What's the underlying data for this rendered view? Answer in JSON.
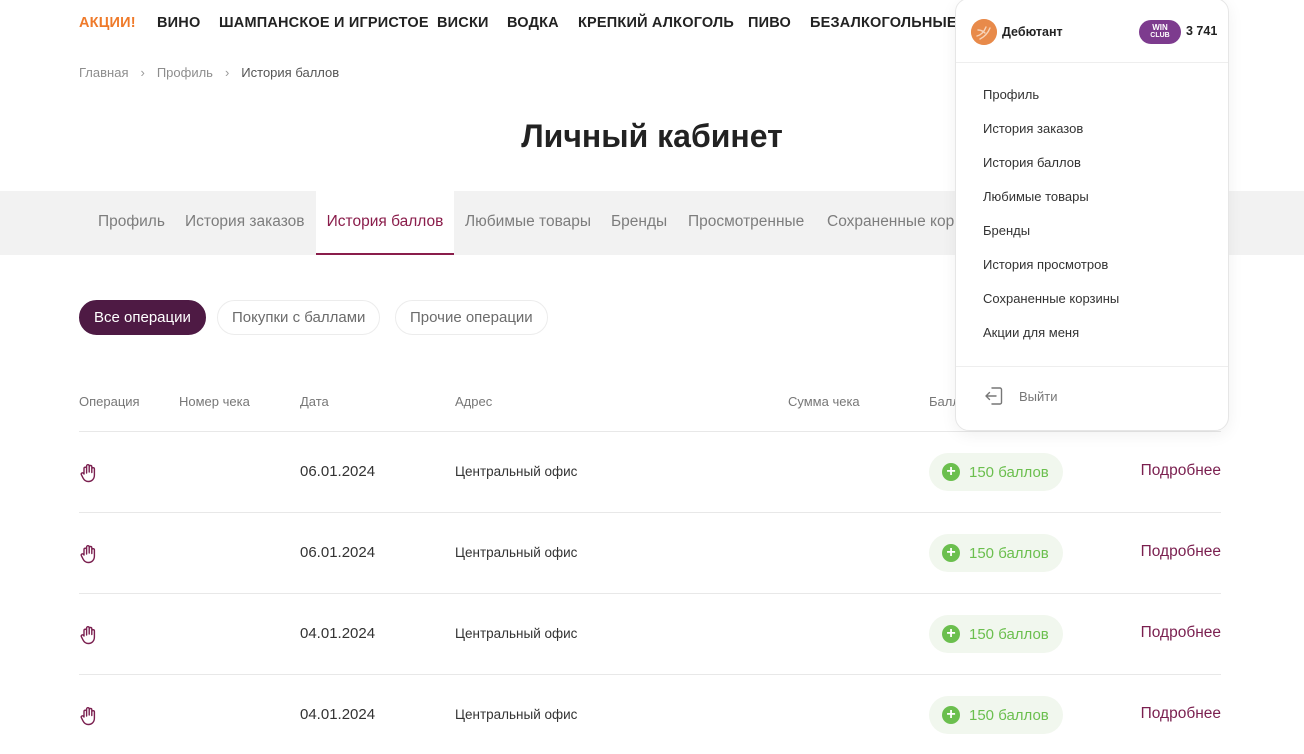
{
  "nav": {
    "items": [
      "АКЦИИ!",
      "ВИНО",
      "ШАМПАНСКОЕ И ИГРИСТОЕ",
      "ВИСКИ",
      "ВОДКА",
      "КРЕПКИЙ АЛКОГОЛЬ",
      "ПИВО",
      "БЕЗАЛКОГОЛЬНЫЕ Н"
    ],
    "promo_color": "#ef7a2a"
  },
  "breadcrumb": [
    "Главная",
    "Профиль",
    "История баллов"
  ],
  "page_title": "Личный кабинет",
  "tabs": {
    "items": [
      "Профиль",
      "История заказов",
      "История баллов",
      "Любимые товары",
      "Бренды",
      "Просмотренные",
      "Сохраненные кор"
    ],
    "active": "История баллов"
  },
  "filters": [
    "Все операции",
    "Покупки с баллами",
    "Прочие операции"
  ],
  "table": {
    "headers": [
      "Операция",
      "Номер чека",
      "Дата",
      "Адрес",
      "Сумма чека",
      "Балл"
    ],
    "rows": [
      {
        "date": "06.01.2024",
        "address": "Центральный офис",
        "points": "150 баллов",
        "more": "Подробнее"
      },
      {
        "date": "06.01.2024",
        "address": "Центральный офис",
        "points": "150 баллов",
        "more": "Подробнее"
      },
      {
        "date": "04.01.2024",
        "address": "Центральный офис",
        "points": "150 баллов",
        "more": "Подробнее"
      },
      {
        "date": "04.01.2024",
        "address": "Центральный офис",
        "points": "150 баллов",
        "more": "Подробнее"
      }
    ]
  },
  "account_menu": {
    "level": "Дебютант",
    "badge_line1": "WIN",
    "badge_line2": "CLUB",
    "balance": "3 741",
    "items": [
      "Профиль",
      "История заказов",
      "История баллов",
      "Любимые товары",
      "Бренды",
      "История просмотров",
      "Сохраненные корзины",
      "Акции для меня"
    ],
    "logout": "Выйти"
  },
  "colors": {
    "accent": "#8a1d4b",
    "chip_active": "#4e1a44",
    "points_green": "#6bbf4e",
    "badge_purple": "#7d3b8e"
  },
  "icons": {
    "operation": "hand-icon",
    "points": "plus-circle-icon",
    "breadcrumb_separator": "chevron-right-icon",
    "logout": "logout-icon"
  }
}
